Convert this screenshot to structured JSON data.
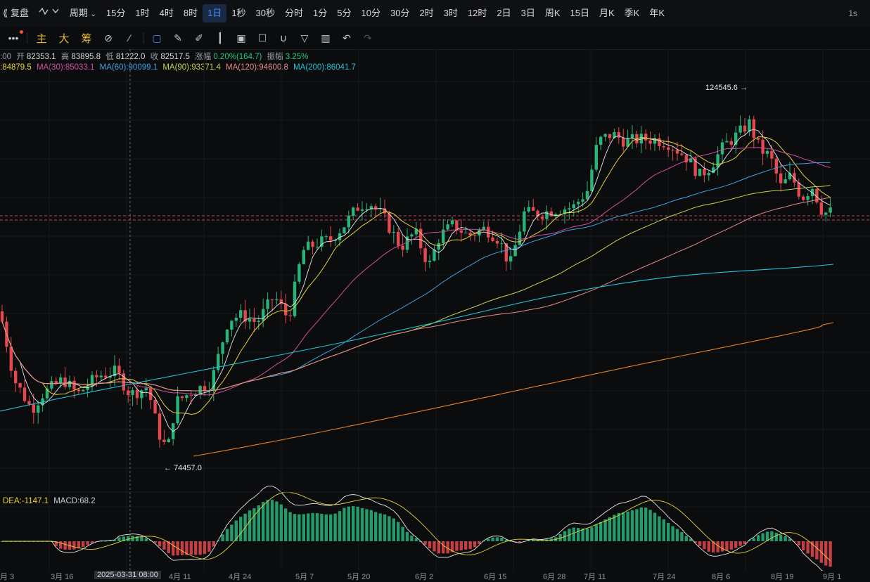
{
  "topbar": {
    "items": [
      {
        "name": "back-button",
        "label": "复盘"
      },
      {
        "name": "indicator-icon",
        "label": ""
      },
      {
        "name": "period-dropdown",
        "label": "周期"
      },
      {
        "name": "tf-15m",
        "label": "15分"
      },
      {
        "name": "tf-1h",
        "label": "1时"
      },
      {
        "name": "tf-4h",
        "label": "4时"
      },
      {
        "name": "tf-8h",
        "label": "8时"
      },
      {
        "name": "tf-1d",
        "label": "1日",
        "active": true
      },
      {
        "name": "tf-1s",
        "label": "1秒"
      },
      {
        "name": "tf-30s",
        "label": "30秒"
      },
      {
        "name": "tf-timeshare",
        "label": "分时"
      },
      {
        "name": "tf-1m",
        "label": "1分"
      },
      {
        "name": "tf-5m",
        "label": "5分"
      },
      {
        "name": "tf-10m",
        "label": "10分"
      },
      {
        "name": "tf-30m",
        "label": "30分"
      },
      {
        "name": "tf-2h",
        "label": "2时"
      },
      {
        "name": "tf-3h",
        "label": "3时"
      },
      {
        "name": "tf-12h",
        "label": "12时"
      },
      {
        "name": "tf-2d",
        "label": "2日"
      },
      {
        "name": "tf-3d",
        "label": "3日"
      },
      {
        "name": "tf-1w",
        "label": "周K"
      },
      {
        "name": "tf-15d",
        "label": "15日"
      },
      {
        "name": "tf-1mo",
        "label": "月K"
      },
      {
        "name": "tf-quarter",
        "label": "季K"
      },
      {
        "name": "tf-year",
        "label": "年K"
      }
    ],
    "right_label": "1s"
  },
  "toolbar": {
    "main_label": "主",
    "big_label": "大",
    "chips_label": "筹"
  },
  "info": {
    "date_fragment": ":00",
    "open_label": "开",
    "open": "82353.1",
    "high_label": "高",
    "high": "83895.8",
    "low_label": "低",
    "low": "81222.0",
    "close_label": "收",
    "close": "82517.5",
    "change_label": "涨幅",
    "change": "0.20%(164.7)",
    "amplitude_label": "振幅",
    "amplitude": "3.25%"
  },
  "ma": [
    {
      "label": ":84879.5",
      "color": "#e8d33a"
    },
    {
      "label": "MA(30):85033.1",
      "color": "#d24fa0"
    },
    {
      "label": "MA(60):90099.1",
      "color": "#3fa3e0"
    },
    {
      "label": "MA(90):93371.4",
      "color": "#c9d34a"
    },
    {
      "label": "MA(120):94600.8",
      "color": "#e88a8a"
    },
    {
      "label": "MA(200):86041.7",
      "color": "#22c3d4"
    }
  ],
  "marks": {
    "high": "124545.6",
    "low": "74457.0",
    "high_arrow": "→",
    "low_arrow": "←"
  },
  "macd": {
    "dea_label": "DEA:-1147.1",
    "macd_label": "MACD:68.2"
  },
  "xaxis": [
    {
      "label": "月 3"
    },
    {
      "label": "3月 16"
    },
    {
      "label": "2025-03-31 08:00",
      "highlight": true
    },
    {
      "label": "4月 11"
    },
    {
      "label": "4月 24"
    },
    {
      "label": "5月 7"
    },
    {
      "label": "5月 20"
    },
    {
      "label": "6月 2"
    },
    {
      "label": "6月 15"
    },
    {
      "label": "6月 28"
    },
    {
      "label": "7月 11"
    },
    {
      "label": "7月 24"
    },
    {
      "label": "8月 6"
    },
    {
      "label": "8月 19"
    },
    {
      "label": "9月 1"
    }
  ],
  "colors": {
    "up": "#29b57a",
    "down": "#e5484d",
    "grid": "#16181c",
    "background": "#0b0c0e",
    "dif": "#e8e8e8",
    "dea": "#e8d33a",
    "ema_orange": "#e8822a"
  }
}
